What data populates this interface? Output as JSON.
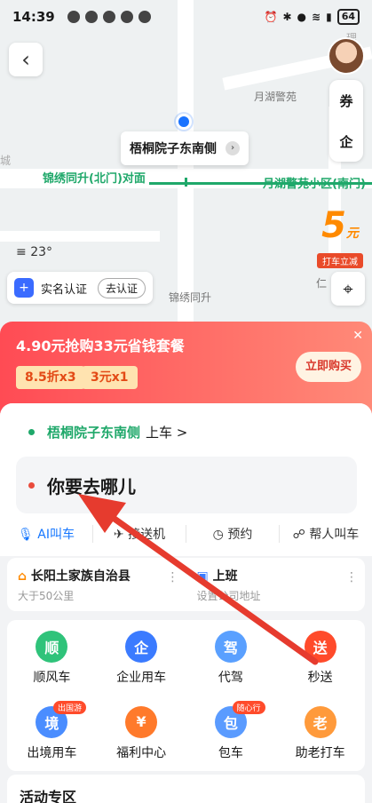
{
  "status": {
    "time": "14:39",
    "battery": "64"
  },
  "map": {
    "pin_label": "梧桐院子东南侧",
    "labels": [
      "月湖警苑",
      "锦绣同升(北门)对面",
      "月湖警苑小区(南门)",
      "锦绣同升",
      "仁",
      "理",
      "城"
    ],
    "temperature": "23°",
    "promo_num": "5",
    "promo_unit": "元",
    "promo_tag": "打车立减",
    "verify": {
      "text": "实名认证",
      "button": "去认证"
    },
    "tool_ticket": "券",
    "tool_enterprise": "企"
  },
  "promo": {
    "title": "4.90元抢购33元省钱套餐",
    "coupon1": "8.5折x3",
    "coupon2": "3元x1",
    "buy": "立即购买"
  },
  "trip": {
    "pickup_place": "梧桐院子东南侧",
    "pickup_suffix": "上车 >",
    "dest_placeholder": "你要去哪儿",
    "tabs": [
      "AI叫车",
      "接送机",
      "预约",
      "帮人叫车"
    ]
  },
  "addresses": [
    {
      "name": "长阳土家族自治县",
      "sub": "大于50公里"
    },
    {
      "name": "上班",
      "sub": "设置公司地址"
    }
  ],
  "services": [
    {
      "label": "顺风车",
      "icon": "顺",
      "color": "#2fc37a"
    },
    {
      "label": "企业用车",
      "icon": "企",
      "color": "#3b7bff"
    },
    {
      "label": "代驾",
      "icon": "驾",
      "color": "#5aa0ff"
    },
    {
      "label": "秒送",
      "icon": "送",
      "color": "#ff4b2b"
    },
    {
      "label": "出境用车",
      "icon": "境",
      "color": "#4a8dff",
      "badge": "出国游"
    },
    {
      "label": "福利中心",
      "icon": "¥",
      "color": "#ff7a2b"
    },
    {
      "label": "包车",
      "icon": "包",
      "color": "#5a9bff",
      "badge": "随心行"
    },
    {
      "label": "助老打车",
      "icon": "老",
      "color": "#ff9a3b"
    }
  ],
  "activity_title": "活动专区"
}
